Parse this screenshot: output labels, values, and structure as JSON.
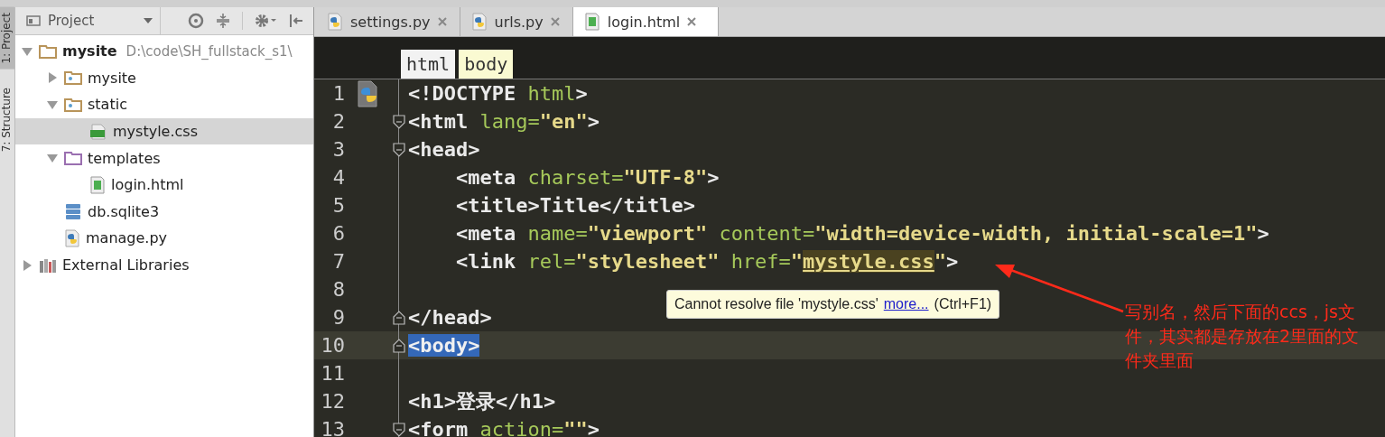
{
  "side_tabs": [
    {
      "label": "1: Project",
      "selected": true
    },
    {
      "label": "7: Structure",
      "selected": false
    }
  ],
  "project_panel": {
    "title": "Project",
    "tree": [
      {
        "name": "mysite",
        "kind": "project",
        "path": "D:\\code\\SH_fullstack_s1\\",
        "expanded": true,
        "selected": false,
        "children": [
          {
            "name": "mysite",
            "kind": "package",
            "expanded": false,
            "selected": false
          },
          {
            "name": "static",
            "kind": "package",
            "expanded": true,
            "selected": false,
            "children": [
              {
                "name": "mystyle.css",
                "kind": "css",
                "selected": true
              }
            ]
          },
          {
            "name": "templates",
            "kind": "templates",
            "expanded": true,
            "selected": false,
            "children": [
              {
                "name": "login.html",
                "kind": "html",
                "selected": false
              }
            ]
          },
          {
            "name": "db.sqlite3",
            "kind": "db",
            "selected": false
          },
          {
            "name": "manage.py",
            "kind": "python",
            "selected": false
          }
        ]
      },
      {
        "name": "External Libraries",
        "kind": "library",
        "expanded": false,
        "selected": false
      }
    ]
  },
  "editor_tabs": [
    {
      "label": "settings.py",
      "kind": "python",
      "selected": false
    },
    {
      "label": "urls.py",
      "kind": "python",
      "selected": false
    },
    {
      "label": "login.html",
      "kind": "html",
      "selected": true
    }
  ],
  "breadcrumbs": [
    {
      "label": "html",
      "selected": false
    },
    {
      "label": "body",
      "selected": true
    }
  ],
  "code_lines": [
    {
      "number": "1",
      "kind": "plain",
      "run_marker": true,
      "current": false,
      "segments": [
        {
          "kind": "tag",
          "text": "<!DOCTYPE "
        },
        {
          "kind": "attr",
          "text": "html"
        },
        {
          "kind": "tag",
          "text": ">"
        }
      ]
    },
    {
      "number": "2",
      "kind": "fold_start",
      "run_marker": false,
      "current": false,
      "segments": [
        {
          "kind": "tag",
          "text": "<html "
        },
        {
          "kind": "attr",
          "text": "lang="
        },
        {
          "kind": "value",
          "text": "\"en\""
        },
        {
          "kind": "tag",
          "text": ">"
        }
      ]
    },
    {
      "number": "3",
      "kind": "fold_start",
      "run_marker": false,
      "current": false,
      "segments": [
        {
          "kind": "tag",
          "text": "<head>"
        }
      ]
    },
    {
      "number": "4",
      "kind": "plain",
      "run_marker": false,
      "current": false,
      "segments": [
        {
          "kind": "tag",
          "text": "    <meta "
        },
        {
          "kind": "attr",
          "text": "charset="
        },
        {
          "kind": "value",
          "text": "\"UTF-8\""
        },
        {
          "kind": "tag",
          "text": ">"
        }
      ]
    },
    {
      "number": "5",
      "kind": "plain",
      "run_marker": false,
      "current": false,
      "segments": [
        {
          "kind": "tag",
          "text": "    <title>"
        },
        {
          "kind": "text",
          "text": "Title"
        },
        {
          "kind": "tag",
          "text": "</title>"
        }
      ]
    },
    {
      "number": "6",
      "kind": "plain",
      "run_marker": false,
      "current": false,
      "segments": [
        {
          "kind": "tag",
          "text": "    <meta "
        },
        {
          "kind": "attr",
          "text": "name="
        },
        {
          "kind": "value",
          "text": "\"viewport\" "
        },
        {
          "kind": "attr",
          "text": "content="
        },
        {
          "kind": "value",
          "text": "\"width=device-width, initial-scale=1\""
        },
        {
          "kind": "tag",
          "text": ">"
        }
      ]
    },
    {
      "number": "7",
      "kind": "plain",
      "run_marker": false,
      "current": false,
      "segments": [
        {
          "kind": "tag",
          "text": "    <link "
        },
        {
          "kind": "attr",
          "text": "rel="
        },
        {
          "kind": "value",
          "text": "\"stylesheet\" "
        },
        {
          "kind": "attr",
          "text": "href="
        },
        {
          "kind": "value",
          "text": "\""
        },
        {
          "kind": "error",
          "text": "mystyle.css"
        },
        {
          "kind": "value",
          "text": "\""
        },
        {
          "kind": "tag",
          "text": ">"
        }
      ]
    },
    {
      "number": "8",
      "kind": "plain",
      "run_marker": false,
      "current": false
    },
    {
      "number": "9",
      "kind": "fold_end",
      "run_marker": false,
      "current": false,
      "segments": [
        {
          "kind": "tag",
          "text": "</head>"
        }
      ]
    },
    {
      "number": "10",
      "kind": "fold_end",
      "run_marker": false,
      "current": true,
      "segments": [
        {
          "kind": "selected",
          "text": "<body>"
        }
      ]
    },
    {
      "number": "11",
      "kind": "plain",
      "run_marker": false,
      "current": false
    },
    {
      "number": "12",
      "kind": "plain",
      "run_marker": false,
      "current": false,
      "segments": [
        {
          "kind": "tag",
          "text": "<h1>"
        },
        {
          "kind": "text",
          "text": "登录"
        },
        {
          "kind": "tag",
          "text": "</h1>"
        }
      ]
    },
    {
      "number": "13",
      "kind": "fold_start",
      "run_marker": false,
      "current": false,
      "segments": [
        {
          "kind": "tag",
          "text": "<form "
        },
        {
          "kind": "attr",
          "text": "action="
        },
        {
          "kind": "value",
          "text": "\"\""
        },
        {
          "kind": "tag",
          "text": ">"
        }
      ]
    }
  ],
  "tooltip": {
    "message": "Cannot resolve file 'mystyle.css'",
    "link": "more...",
    "shortcut": "(Ctrl+F1)"
  },
  "annotation": {
    "text": "写别名，然后下面的ccs，js文件，其实都是存放在2里面的文件夹里面"
  }
}
